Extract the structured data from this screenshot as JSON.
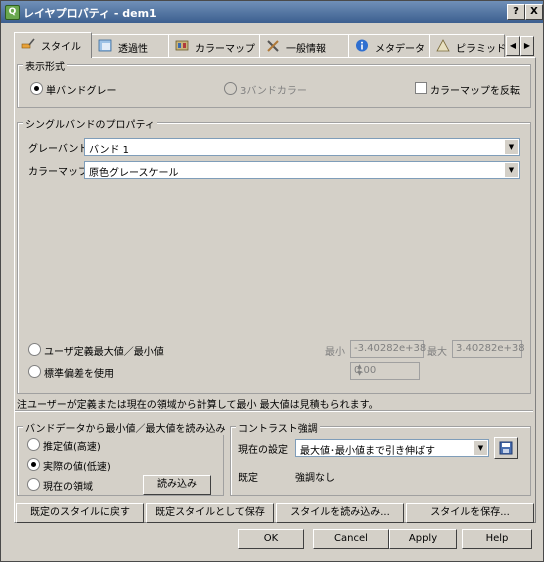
{
  "window": {
    "title": "レイヤプロパティ - dem1",
    "help_btn": "?",
    "close_btn": "X"
  },
  "tabs": [
    {
      "label": "スタイル",
      "icon": "brush-icon"
    },
    {
      "label": "透過性",
      "icon": "transparency-icon"
    },
    {
      "label": "カラーマップ",
      "icon": "colormap-icon"
    },
    {
      "label": "一般情報",
      "icon": "tools-icon"
    },
    {
      "label": "メタデータ",
      "icon": "info-icon"
    },
    {
      "label": "ピラミッド",
      "icon": "pyramid-icon"
    }
  ],
  "display": {
    "title": "表示形式",
    "single_gray": "単バンドグレー",
    "three_band": "3バンドカラー",
    "invert": "カラーマップを反転"
  },
  "single_band": {
    "title": "シングルバンドのプロパティ",
    "gray_band_label": "グレーバンド",
    "gray_band_value": "バンド 1",
    "colormap_label": "カラーマップ",
    "colormap_value": "原色グレースケール",
    "user_minmax": "ユーザ定義最大値／最小値",
    "min_label": "最小",
    "min_value": "-3.40282e+38",
    "max_label": "最大",
    "max_value": "3.40282e+38",
    "stddev": "標準偏差を使用",
    "stddev_value": "0.00"
  },
  "note": "注ユーザーが定義または現在の領域から計算して最小  最大値は見積もられます。",
  "load_minmax": {
    "title": "バンドデータから最小値／最大値を読み込み",
    "estimate": "推定値(高速)",
    "actual": "実際の値(低速)",
    "current_extent": "現在の領域",
    "load_btn": "読み込み"
  },
  "contrast": {
    "title": "コントラスト強調",
    "current_label": "現在の設定",
    "current_value": "最大値･最小値まで引き伸ばす",
    "default_label": "既定",
    "default_value": "強調なし"
  },
  "style_buttons": {
    "restore": "既定のスタイルに戻す",
    "save_default": "既定スタイルとして保存",
    "load": "スタイルを読み込み...",
    "save": "スタイルを保存..."
  },
  "dialog_buttons": {
    "ok": "OK",
    "cancel": "Cancel",
    "apply": "Apply",
    "help": "Help"
  }
}
